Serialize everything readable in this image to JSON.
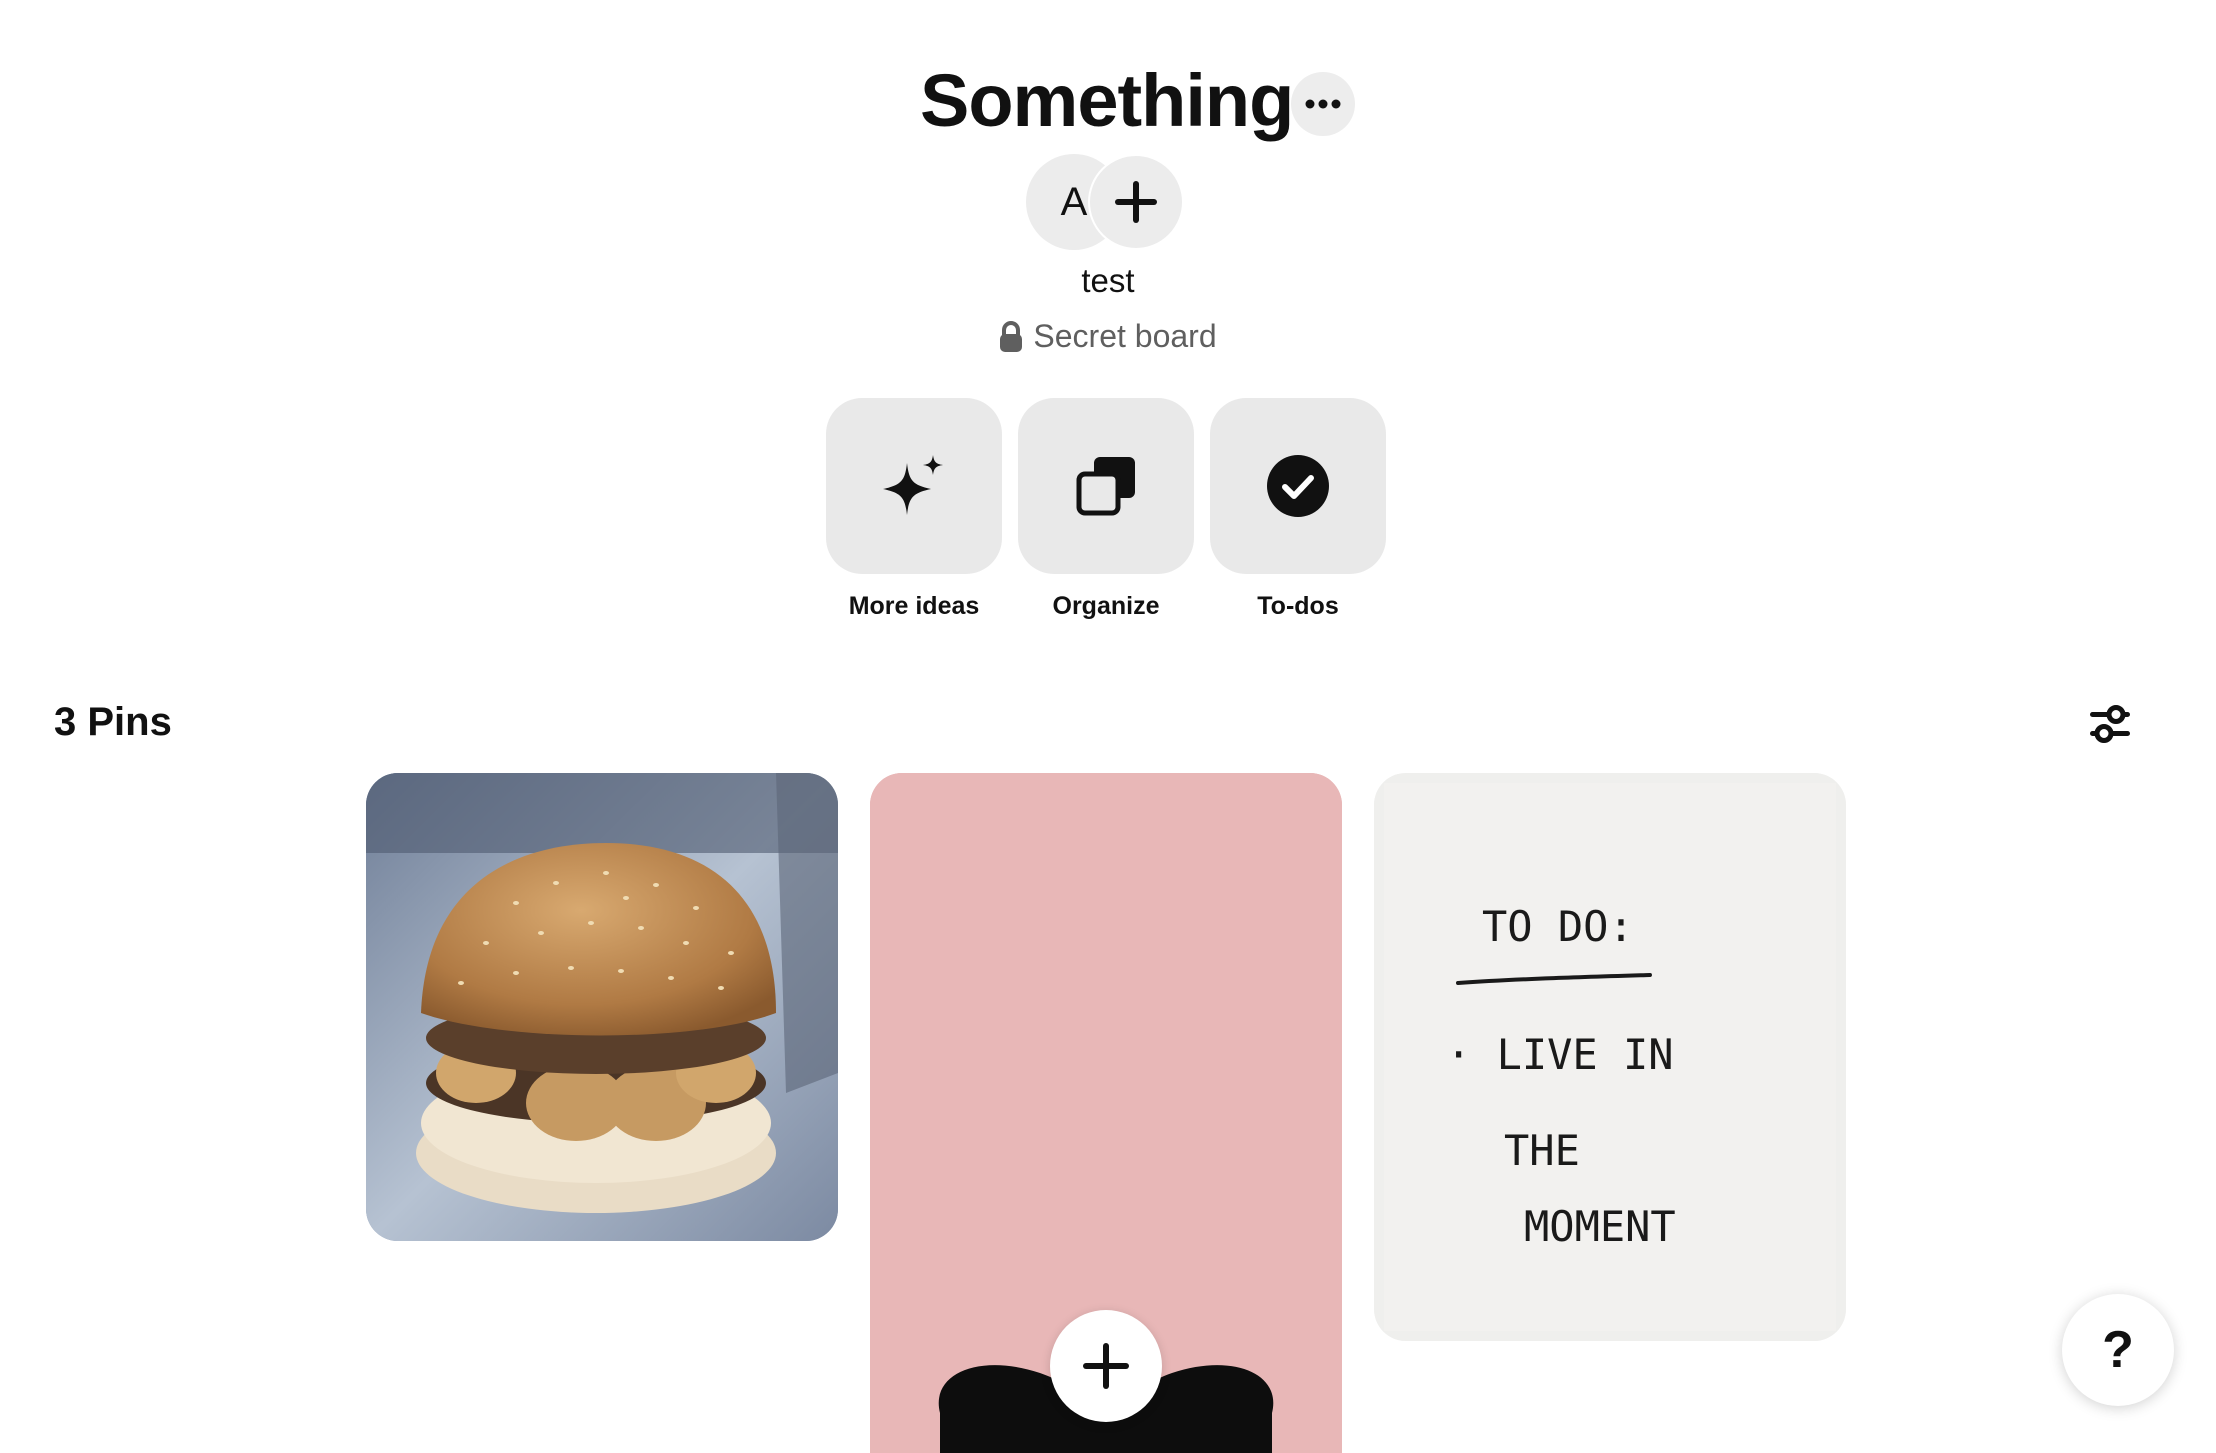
{
  "board": {
    "title": "Something",
    "more_icon": "ellipsis-icon",
    "owner_initial": "A",
    "owner_name": "test",
    "visibility_label": "Secret board"
  },
  "tools": [
    {
      "label": "More ideas",
      "icon": "sparkle-icon"
    },
    {
      "label": "Organize",
      "icon": "organize-icon"
    },
    {
      "label": "To-dos",
      "icon": "checkmark-circle-icon"
    }
  ],
  "pins": {
    "count_label": "3 Pins",
    "items": [
      {
        "kind": "burger-photo"
      },
      {
        "kind": "pink-bow-image"
      },
      {
        "kind": "handwritten-note",
        "note_lines": [
          "TO DO:",
          "· LIVE IN",
          "THE",
          "MOMENT"
        ]
      }
    ]
  },
  "help_label": "?"
}
